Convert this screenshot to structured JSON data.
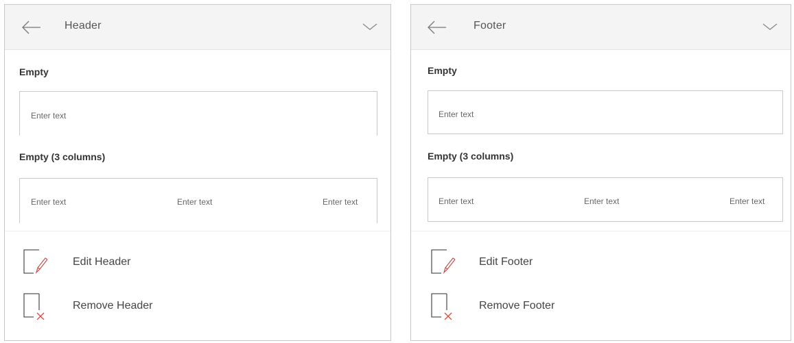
{
  "panels": [
    {
      "title": "Header",
      "back_icon": "arrow-left-icon",
      "collapse_icon": "chevron-down-icon",
      "presets": {
        "empty": {
          "label": "Empty",
          "placeholder": "Enter text"
        },
        "three_columns": {
          "label": "Empty (3 columns)",
          "placeholders": [
            "Enter text",
            "Enter text",
            "Enter text"
          ]
        }
      },
      "actions": {
        "edit": {
          "label": "Edit Header",
          "icon": "page-edit-icon"
        },
        "remove": {
          "label": "Remove Header",
          "icon": "page-remove-icon"
        }
      }
    },
    {
      "title": "Footer",
      "back_icon": "arrow-left-icon",
      "collapse_icon": "chevron-down-icon",
      "presets": {
        "empty": {
          "label": "Empty",
          "placeholder": "Enter text"
        },
        "three_columns": {
          "label": "Empty (3 columns)",
          "placeholders": [
            "Enter text",
            "Enter text",
            "Enter text"
          ]
        }
      },
      "actions": {
        "edit": {
          "label": "Edit Footer",
          "icon": "page-edit-icon"
        },
        "remove": {
          "label": "Remove Footer",
          "icon": "page-remove-icon"
        }
      }
    }
  ],
  "colors": {
    "header_bg": "#f4f4f4",
    "border": "#c9c9c9",
    "icon_line": "#555555",
    "icon_accent": "#c0504d",
    "remove_x": "#e0453a"
  }
}
